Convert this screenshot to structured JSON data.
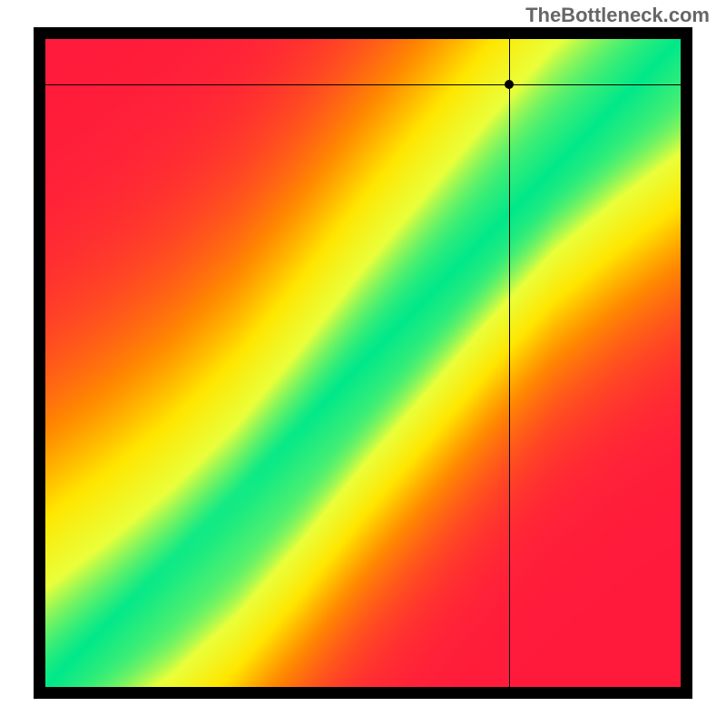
{
  "watermark": "TheBottleneck.com",
  "chart_data": {
    "type": "heatmap",
    "title": "",
    "xlabel": "",
    "ylabel": "",
    "xlim": [
      0,
      100
    ],
    "ylim": [
      0,
      100
    ],
    "crosshair": {
      "x": 73,
      "y": 93
    },
    "optimal_band": {
      "description": "green optimal-compatibility band running diagonally from bottom-left to top-right with slight S-curve",
      "points": [
        {
          "x": 0,
          "y": 0
        },
        {
          "x": 10,
          "y": 6
        },
        {
          "x": 20,
          "y": 13
        },
        {
          "x": 30,
          "y": 22
        },
        {
          "x": 40,
          "y": 34
        },
        {
          "x": 50,
          "y": 47
        },
        {
          "x": 60,
          "y": 59
        },
        {
          "x": 70,
          "y": 71
        },
        {
          "x": 80,
          "y": 82
        },
        {
          "x": 90,
          "y": 90
        },
        {
          "x": 100,
          "y": 97
        }
      ],
      "band_width_frac": 0.06
    },
    "colorscale": [
      {
        "stop": 0.0,
        "color": "#ff1a3c"
      },
      {
        "stop": 0.35,
        "color": "#ff8a00"
      },
      {
        "stop": 0.6,
        "color": "#ffe600"
      },
      {
        "stop": 0.82,
        "color": "#eaff3a"
      },
      {
        "stop": 1.0,
        "color": "#00e88a"
      }
    ]
  }
}
